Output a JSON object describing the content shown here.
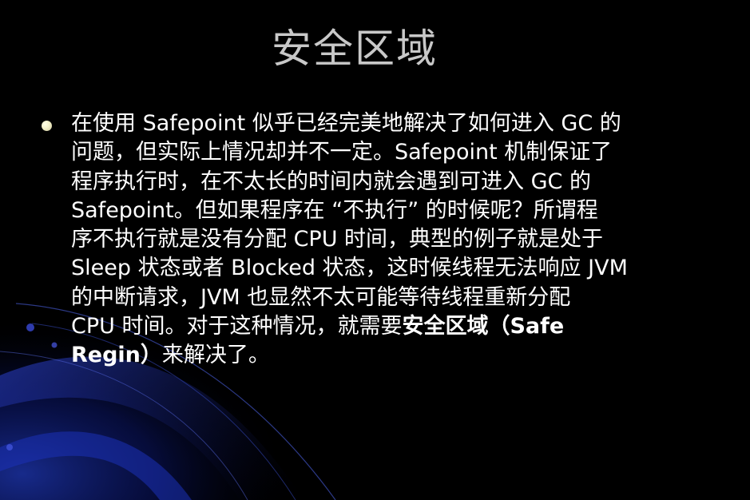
{
  "slide": {
    "title": "安全区域",
    "lines": [
      "在使用 Safepoint 似乎已经完美地解决了如何进入 GC 的",
      "问题，但实际上情况却并不一定。Safepoint 机制保证了",
      "程序执行时，在不太长的时间内就会遇到可进入 GC 的",
      "Safepoint。但如果程序在 “不执行” 的时候呢？所谓程",
      "序不执行就是没有分配 CPU 时间，典型的例子就是处于",
      "Sleep 状态或者 Blocked 状态，这时候线程无法响应 JVM",
      "的中断请求，JVM 也显然不太可能等待线程重新分配"
    ],
    "line8_normal": "CPU 时间。对于这种情况，就需要",
    "line8_bold": "安全区域（Safe",
    "line9_bold": "Regin）",
    "line9_normal": "来解决了。"
  }
}
